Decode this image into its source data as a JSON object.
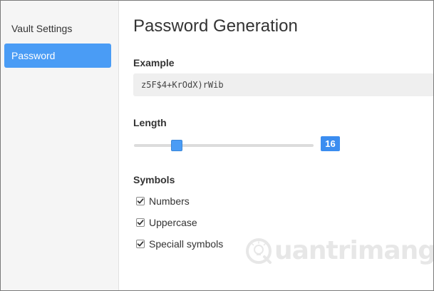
{
  "sidebar": {
    "items": [
      {
        "label": "Vault Settings",
        "active": false
      },
      {
        "label": "Password",
        "active": true
      }
    ]
  },
  "main": {
    "title": "Password Generation",
    "example": {
      "label": "Example",
      "value": "z5F$4+KrOdX)rWib"
    },
    "length": {
      "label": "Length",
      "value": "16",
      "slider_fraction": 0.24
    },
    "symbols": {
      "label": "Symbols",
      "options": [
        {
          "label": "Numbers",
          "checked": true
        },
        {
          "label": "Uppercase",
          "checked": true
        },
        {
          "label": "Speciall symbols",
          "checked": true
        }
      ]
    }
  },
  "watermark": {
    "text": "uantrimang",
    "icon": "lightbulb-q-icon"
  },
  "colors": {
    "accent": "#4a9cf5",
    "badge": "#3b8df0",
    "sidebar_bg": "#f5f5f5",
    "example_bg": "#efefef"
  }
}
